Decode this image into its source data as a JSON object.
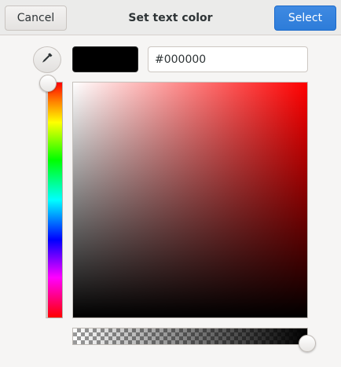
{
  "dialog": {
    "title": "Set text color",
    "cancel_label": "Cancel",
    "select_label": "Select"
  },
  "picker": {
    "hex_value": "#000000",
    "current_color": "#000000",
    "hue_fraction": 0.0,
    "saturation": 0.0,
    "value": 0.0,
    "alpha": 1.0,
    "eyedropper_icon": "eyedropper-icon"
  },
  "colors": {
    "accent": "#3584e4",
    "headerbar": "#ebebea",
    "background": "#f6f5f4"
  }
}
